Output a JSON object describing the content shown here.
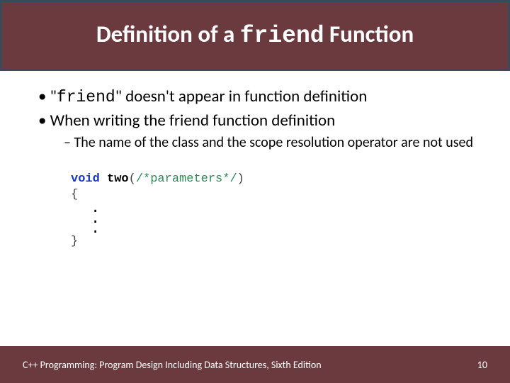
{
  "title": {
    "pre": "Definition of a ",
    "code": "friend",
    "post": " Function"
  },
  "bullets": {
    "b1_pre": "\"",
    "b1_code": "friend",
    "b1_post": "\" doesn't appear in function definition",
    "b2": "When writing the friend function definition",
    "b2_sub": "The name of the class and the scope resolution operator are not used"
  },
  "code": {
    "kw_void": "void",
    "fn_name": " two",
    "params_open": "(",
    "params_comment": "/*parameters*/",
    "params_close": ")",
    "brace_open": "{",
    "dot": ".",
    "brace_close": "}"
  },
  "footer": {
    "left": "C++ Programming: Program Design Including Data Structures, Sixth Edition",
    "right": "10"
  }
}
